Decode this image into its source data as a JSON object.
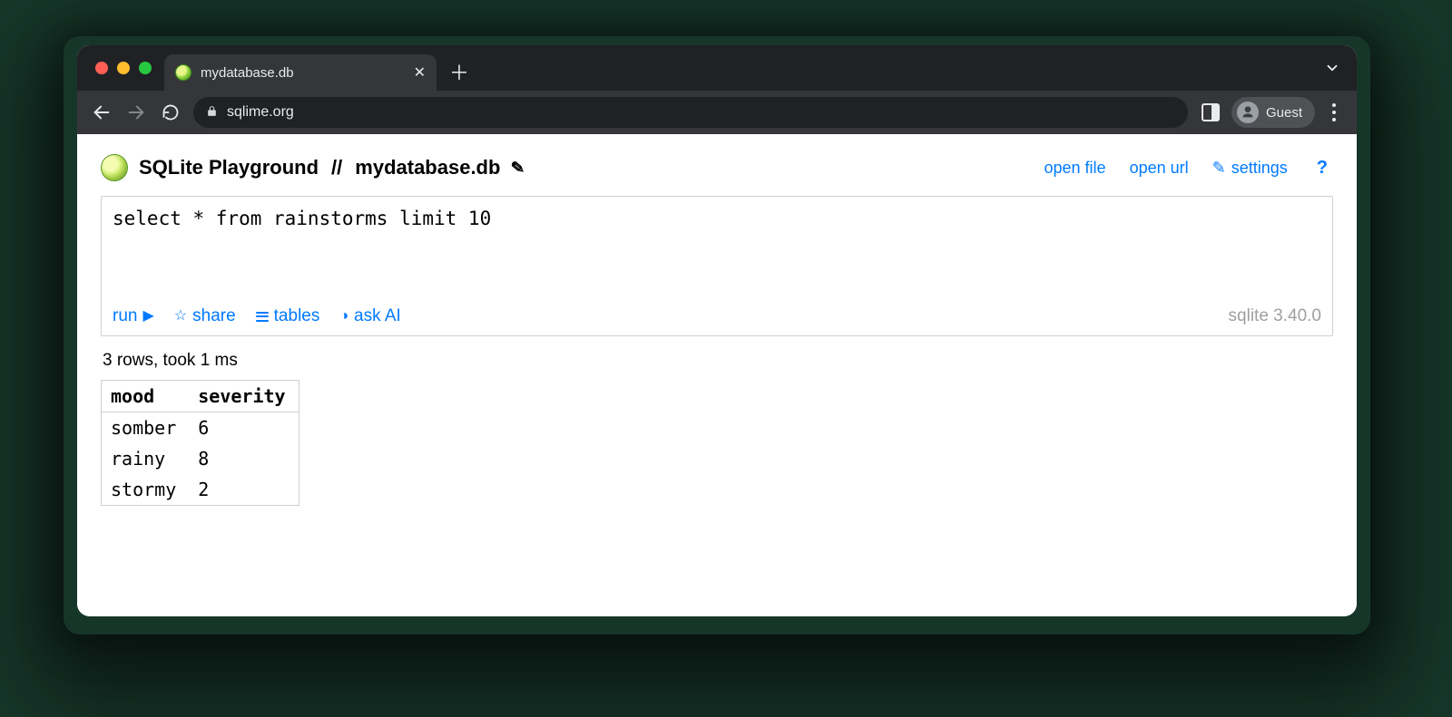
{
  "browser": {
    "tab_title": "mydatabase.db",
    "chevron_glyph": "⌄",
    "url_host": "sqlime.org",
    "profile_label": "Guest"
  },
  "header": {
    "app_name": "SQLite Playground",
    "separator": "//",
    "db_name": "mydatabase.db",
    "pencil_glyph": "✎",
    "links": {
      "open_file": "open file",
      "open_url": "open url",
      "settings": "settings",
      "settings_icon": "✎",
      "help": "?"
    }
  },
  "editor": {
    "query": "select * from rainstorms limit 10",
    "actions": {
      "run": "run",
      "run_icon": "▶",
      "share": "share",
      "share_icon": "☆",
      "tables": "tables",
      "ask_ai": "ask AI",
      "ask_ai_icon": "◑"
    },
    "sqlite_version": "sqlite 3.40.0"
  },
  "result": {
    "status": "3 rows, took 1 ms",
    "columns": [
      "mood",
      "severity"
    ],
    "rows": [
      {
        "mood": "somber",
        "severity": "6"
      },
      {
        "mood": "rainy",
        "severity": "8"
      },
      {
        "mood": "stormy",
        "severity": "2"
      }
    ]
  }
}
